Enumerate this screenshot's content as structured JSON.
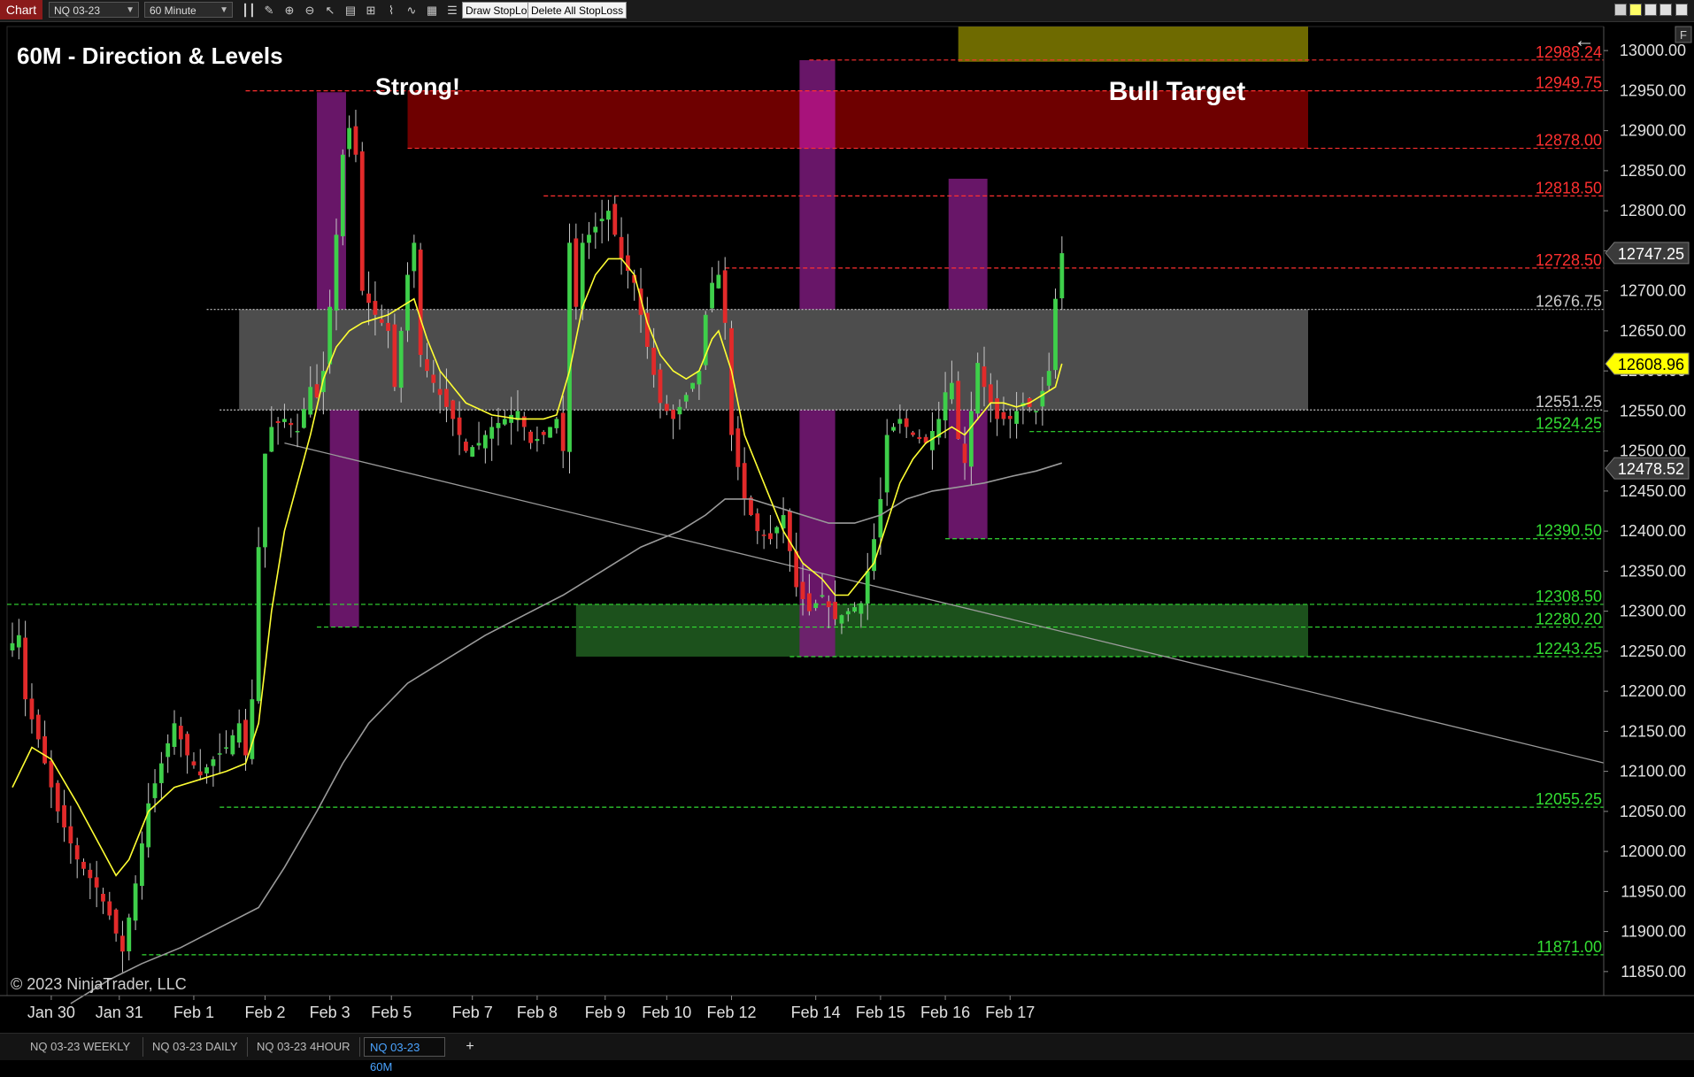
{
  "toolbar": {
    "chart_label": "Chart",
    "instrument": "NQ 03-23",
    "interval": "60 Minute",
    "draw_stoploss": "Draw StopLoss",
    "delete_stoploss": "Delete All StopLoss",
    "icons": [
      "bar-type-icon",
      "pencil-icon",
      "zoom-in-icon",
      "zoom-out-icon",
      "pointer-icon",
      "data-box-icon",
      "properties-icon",
      "strategies-icon",
      "indicators-icon",
      "templates-icon",
      "list-icon"
    ],
    "side_tab": "F"
  },
  "chart": {
    "title": "60M - Direction & Levels",
    "label_strong": "Strong!",
    "label_bull_target": "Bull Target",
    "copyright": "© 2023 NinjaTrader, LLC",
    "arrow": "←",
    "colors": {
      "background": "#000000",
      "up": "#3ecf4a",
      "down": "#e22a2a",
      "ma_fast": "#ffff33",
      "ma_slow": "#9a9a9a",
      "resistance": "#ff2a2a",
      "support": "#33cc33",
      "zone_red": "#6e0000",
      "zone_green": "#1f5a1f",
      "zone_grey": "#5a5a5a",
      "zone_purple": "#7a1a7a",
      "zone_olive": "#6e6a00",
      "price_yellow": "#ffff00"
    }
  },
  "chart_data": {
    "type": "candlestick",
    "instrument": "NQ 03-23",
    "interval": "60 Minute",
    "ylim": [
      11820,
      13030
    ],
    "y_ticks": [
      "13000.00",
      "12950.00",
      "12900.00",
      "12850.00",
      "12800.00",
      "12750.00",
      "12700.00",
      "12650.00",
      "12600.00",
      "12550.00",
      "12500.00",
      "12450.00",
      "12400.00",
      "12350.00",
      "12300.00",
      "12250.00",
      "12200.00",
      "12150.00",
      "12100.00",
      "12050.00",
      "12000.00",
      "11950.00",
      "11900.00",
      "11850.00"
    ],
    "x_ticks": [
      "Jan 30",
      "Jan 31",
      "Feb 1",
      "Feb 2",
      "Feb 3",
      "Feb 5",
      "Feb 7",
      "Feb 8",
      "Feb 9",
      "Feb 10",
      "Feb 12",
      "Feb 14",
      "Feb 15",
      "Feb 16",
      "Feb 17"
    ],
    "levels": [
      {
        "label": "12988.24",
        "value": 12988.24,
        "kind": "resistance"
      },
      {
        "label": "12949.75",
        "value": 12949.75,
        "kind": "resistance"
      },
      {
        "label": "12878.00",
        "value": 12878.0,
        "kind": "resistance"
      },
      {
        "label": "12818.50",
        "value": 12818.5,
        "kind": "resistance"
      },
      {
        "label": "12728.50",
        "value": 12728.5,
        "kind": "resistance"
      },
      {
        "label": "12676.75",
        "value": 12676.75,
        "kind": "neutral"
      },
      {
        "label": "12551.25",
        "value": 12551.25,
        "kind": "neutral"
      },
      {
        "label": "12524.25",
        "value": 12524.25,
        "kind": "support"
      },
      {
        "label": "12390.50",
        "value": 12390.5,
        "kind": "support"
      },
      {
        "label": "12308.50",
        "value": 12308.5,
        "kind": "support"
      },
      {
        "label": "12280.20",
        "value": 12280.2,
        "kind": "support"
      },
      {
        "label": "12243.25",
        "value": 12243.25,
        "kind": "support"
      },
      {
        "label": "12055.25",
        "value": 12055.25,
        "kind": "support"
      },
      {
        "label": "11871.00",
        "value": 11871.0,
        "kind": "support"
      }
    ],
    "price_markers": [
      {
        "label": "12747.25",
        "value": 12747.25,
        "style": "last"
      },
      {
        "label": "12608.96",
        "value": 12608.96,
        "style": "ma-fast"
      },
      {
        "label": "12478.52",
        "value": 12478.52,
        "style": "ma-slow"
      }
    ],
    "series": [
      {
        "name": "price",
        "points": [
          [
            0,
            12260
          ],
          [
            0.5,
            12310
          ],
          [
            2,
            12190
          ],
          [
            4,
            12140
          ],
          [
            7,
            12050
          ],
          [
            10,
            11990
          ],
          [
            13,
            11955
          ],
          [
            15,
            11920
          ],
          [
            17,
            11875
          ],
          [
            19,
            11960
          ],
          [
            21,
            12060
          ],
          [
            23,
            12110
          ],
          [
            25,
            12160
          ],
          [
            27,
            12120
          ],
          [
            29,
            12095
          ],
          [
            31,
            12115
          ],
          [
            33,
            12130
          ],
          [
            35,
            12160
          ],
          [
            36.5,
            12100
          ],
          [
            37.5,
            12280
          ],
          [
            38.5,
            12480
          ],
          [
            40,
            12530
          ],
          [
            42,
            12540
          ],
          [
            44,
            12525
          ],
          [
            46,
            12580
          ],
          [
            47.5,
            12560
          ],
          [
            49,
            12680
          ],
          [
            50,
            12770
          ],
          [
            51.5,
            12920
          ],
          [
            53,
            12870
          ],
          [
            54,
            12700
          ],
          [
            56,
            12670
          ],
          [
            58,
            12650
          ],
          [
            59,
            12580
          ],
          [
            61,
            12720
          ],
          [
            62,
            12760
          ],
          [
            63,
            12620
          ],
          [
            64,
            12600
          ],
          [
            66,
            12570
          ],
          [
            68,
            12540
          ],
          [
            70,
            12500
          ],
          [
            72,
            12510
          ],
          [
            74,
            12530
          ],
          [
            76,
            12540
          ],
          [
            78,
            12550
          ],
          [
            80,
            12510
          ],
          [
            82,
            12520
          ],
          [
            84,
            12540
          ],
          [
            85,
            12500
          ],
          [
            86,
            12760
          ],
          [
            87,
            12680
          ],
          [
            88,
            12760
          ],
          [
            90,
            12780
          ],
          [
            92,
            12800
          ],
          [
            94,
            12740
          ],
          [
            96,
            12710
          ],
          [
            98,
            12630
          ],
          [
            100,
            12560
          ],
          [
            102,
            12540
          ],
          [
            104,
            12570
          ],
          [
            106,
            12600
          ],
          [
            107,
            12670
          ],
          [
            108,
            12710
          ],
          [
            109,
            12720
          ],
          [
            110,
            12660
          ],
          [
            111,
            12520
          ],
          [
            113,
            12440
          ],
          [
            115,
            12400
          ],
          [
            117,
            12390
          ],
          [
            119,
            12420
          ],
          [
            121,
            12330
          ],
          [
            123,
            12300
          ],
          [
            125,
            12320
          ],
          [
            127,
            12290
          ],
          [
            129,
            12300
          ],
          [
            131,
            12310
          ],
          [
            133,
            12390
          ],
          [
            134,
            12440
          ],
          [
            135,
            12520
          ],
          [
            137,
            12540
          ],
          [
            139,
            12520
          ],
          [
            141,
            12510
          ],
          [
            143,
            12540
          ],
          [
            144.5,
            12590
          ],
          [
            145.5,
            12580
          ],
          [
            146.5,
            12450
          ],
          [
            147.5,
            12520
          ],
          [
            149,
            12610
          ],
          [
            150,
            12580
          ],
          [
            152,
            12540
          ],
          [
            154,
            12540
          ],
          [
            156,
            12560
          ],
          [
            158,
            12550
          ],
          [
            160,
            12600
          ],
          [
            161,
            12690
          ],
          [
            162,
            12747
          ]
        ]
      },
      {
        "name": "ma_fast",
        "points": [
          [
            0,
            12080
          ],
          [
            3,
            12130
          ],
          [
            6,
            12115
          ],
          [
            10,
            12060
          ],
          [
            14,
            12000
          ],
          [
            16,
            11970
          ],
          [
            18,
            11990
          ],
          [
            21,
            12050
          ],
          [
            25,
            12080
          ],
          [
            29,
            12090
          ],
          [
            33,
            12100
          ],
          [
            36,
            12110
          ],
          [
            38,
            12160
          ],
          [
            40,
            12300
          ],
          [
            42,
            12400
          ],
          [
            44,
            12460
          ],
          [
            46,
            12520
          ],
          [
            48,
            12590
          ],
          [
            50,
            12630
          ],
          [
            52,
            12650
          ],
          [
            54,
            12660
          ],
          [
            56,
            12665
          ],
          [
            58,
            12670
          ],
          [
            60,
            12680
          ],
          [
            62,
            12690
          ],
          [
            64,
            12640
          ],
          [
            66,
            12600
          ],
          [
            68,
            12580
          ],
          [
            70,
            12560
          ],
          [
            74,
            12545
          ],
          [
            78,
            12540
          ],
          [
            82,
            12540
          ],
          [
            84,
            12545
          ],
          [
            86,
            12600
          ],
          [
            88,
            12680
          ],
          [
            90,
            12720
          ],
          [
            92,
            12740
          ],
          [
            94,
            12740
          ],
          [
            96,
            12720
          ],
          [
            98,
            12660
          ],
          [
            100,
            12620
          ],
          [
            102,
            12600
          ],
          [
            104,
            12590
          ],
          [
            106,
            12600
          ],
          [
            108,
            12640
          ],
          [
            109,
            12650
          ],
          [
            111,
            12600
          ],
          [
            113,
            12520
          ],
          [
            116,
            12460
          ],
          [
            119,
            12400
          ],
          [
            122,
            12360
          ],
          [
            125,
            12340
          ],
          [
            127,
            12320
          ],
          [
            129,
            12320
          ],
          [
            131,
            12340
          ],
          [
            133,
            12360
          ],
          [
            135,
            12410
          ],
          [
            137,
            12460
          ],
          [
            139,
            12490
          ],
          [
            141,
            12510
          ],
          [
            143,
            12520
          ],
          [
            145,
            12530
          ],
          [
            147,
            12520
          ],
          [
            149,
            12540
          ],
          [
            151,
            12560
          ],
          [
            153,
            12560
          ],
          [
            155,
            12555
          ],
          [
            157,
            12560
          ],
          [
            159,
            12570
          ],
          [
            161,
            12580
          ],
          [
            162,
            12608.96
          ]
        ]
      },
      {
        "name": "ma_slow",
        "points": [
          [
            9,
            11810
          ],
          [
            15,
            11840
          ],
          [
            20,
            11860
          ],
          [
            26,
            11880
          ],
          [
            32,
            11905
          ],
          [
            38,
            11930
          ],
          [
            42,
            11980
          ],
          [
            47,
            12050
          ],
          [
            51,
            12110
          ],
          [
            55,
            12160
          ],
          [
            61,
            12210
          ],
          [
            67,
            12240
          ],
          [
            73,
            12270
          ],
          [
            79,
            12295
          ],
          [
            85,
            12320
          ],
          [
            91,
            12350
          ],
          [
            97,
            12380
          ],
          [
            103,
            12400
          ],
          [
            107,
            12420
          ],
          [
            110,
            12440
          ],
          [
            114,
            12440
          ],
          [
            118,
            12430
          ],
          [
            122,
            12420
          ],
          [
            126,
            12410
          ],
          [
            130,
            12410
          ],
          [
            134,
            12420
          ],
          [
            138,
            12440
          ],
          [
            142,
            12450
          ],
          [
            146,
            12455
          ],
          [
            150,
            12460
          ],
          [
            154,
            12468
          ],
          [
            158,
            12475
          ],
          [
            162,
            12485
          ]
        ]
      }
    ],
    "trendline": {
      "from": [
        42,
        12510
      ],
      "to": [
        200,
        12200
      ]
    },
    "zones": [
      {
        "kind": "red",
        "x": [
          61,
          200
        ],
        "y": [
          12878,
          12949.75
        ]
      },
      {
        "kind": "grey",
        "x": [
          35,
          200
        ],
        "y": [
          12551.25,
          12676.75
        ]
      },
      {
        "kind": "green",
        "x": [
          87,
          200
        ],
        "y": [
          12243.25,
          12308.5
        ]
      },
      {
        "kind": "olive",
        "x": [
          146,
          200
        ],
        "y": [
          12986,
          13045
        ]
      },
      {
        "kind": "purple",
        "x": [
          47,
          51.5
        ],
        "y": [
          12676.75,
          12948
        ]
      },
      {
        "kind": "purple",
        "x": [
          49,
          53.5
        ],
        "y": [
          12280.2,
          12551.25
        ]
      },
      {
        "kind": "purple",
        "x": [
          121.5,
          127
        ],
        "y": [
          12676.75,
          12988
        ]
      },
      {
        "kind": "magenta",
        "x": [
          121.5,
          127
        ],
        "y": [
          12878,
          12949.75
        ]
      },
      {
        "kind": "purple",
        "x": [
          121.5,
          127
        ],
        "y": [
          12243.25,
          12551.25
        ]
      },
      {
        "kind": "purple",
        "x": [
          144.5,
          150.5
        ],
        "y": [
          12676.75,
          12840
        ]
      },
      {
        "kind": "purple",
        "x": [
          144.5,
          150.5
        ],
        "y": [
          12390.5,
          12551.25
        ]
      }
    ]
  },
  "tabs": [
    {
      "label": "NQ 03-23 WEEKLY",
      "active": false
    },
    {
      "label": "NQ 03-23 DAILY",
      "active": false
    },
    {
      "label": "NQ 03-23 4HOUR",
      "active": false
    },
    {
      "label": "NQ 03-23 60M",
      "active": true
    }
  ],
  "tab_add": "+"
}
